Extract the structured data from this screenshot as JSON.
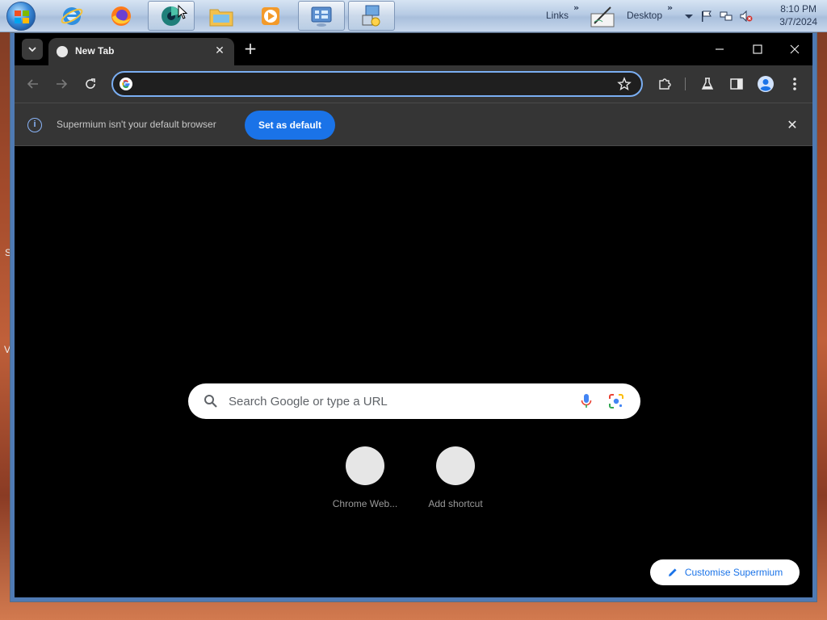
{
  "taskbar": {
    "links_label": "Links",
    "desktop_label": "Desktop",
    "clock_time": "8:10 PM",
    "clock_date": "3/7/2024"
  },
  "desktop": {
    "letters": [
      "S",
      "V"
    ]
  },
  "browser": {
    "tab_title": "New Tab",
    "omnibox_value": "",
    "infobar_text": "Supermium isn't your default browser",
    "infobar_button": "Set as default",
    "ntp": {
      "search_placeholder": "Search Google or type a URL",
      "shortcuts": [
        {
          "label": "Chrome Web..."
        },
        {
          "label": "Add shortcut"
        }
      ],
      "customise_label": "Customise Supermium"
    }
  },
  "colors": {
    "accent": "#1a73e8",
    "omnibox_focus": "#7aaef2",
    "toolbar_bg": "#353535",
    "page_bg": "#000000"
  },
  "icons": [
    "start-orb-icon",
    "internet-explorer-icon",
    "firefox-icon",
    "supermium-icon",
    "file-explorer-icon",
    "media-player-icon",
    "control-panel-icon",
    "network-setup-icon",
    "pen-tablet-icon",
    "flag-icon",
    "network-icon",
    "volume-muted-icon"
  ]
}
